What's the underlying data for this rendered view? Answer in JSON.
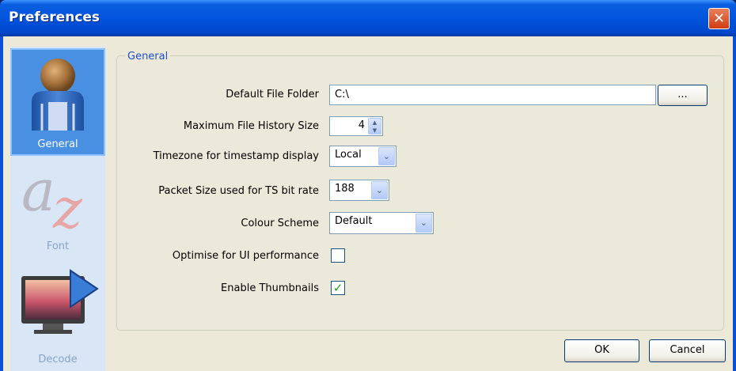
{
  "window": {
    "title": "Preferences"
  },
  "sidebar": {
    "items": [
      {
        "label": "General",
        "icon": "general-user-icon",
        "selected": true
      },
      {
        "label": "Font",
        "icon": "font-az-icon",
        "selected": false
      },
      {
        "label": "Decode",
        "icon": "decode-monitor-icon",
        "selected": false
      }
    ]
  },
  "general": {
    "legend": "General",
    "default_folder": {
      "label": "Default File Folder",
      "value": "C:\\",
      "browse_label": "..."
    },
    "history_size": {
      "label": "Maximum File History Size",
      "value": "4"
    },
    "timezone": {
      "label": "Timezone for timestamp display",
      "value": "Local"
    },
    "packet_size": {
      "label": "Packet Size used for TS bit rate",
      "value": "188"
    },
    "colour_scheme": {
      "label": "Colour Scheme",
      "value": "Default"
    },
    "optimise_ui": {
      "label": "Optimise for UI performance",
      "checked": false
    },
    "thumbnails": {
      "label": "Enable Thumbnails",
      "checked": true,
      "check_mark": "✓"
    }
  },
  "footer": {
    "ok_label": "OK",
    "cancel_label": "Cancel"
  },
  "icons": {
    "close": "✕",
    "dropdown": "⌄",
    "spin_up": "▲",
    "spin_down": "▼"
  }
}
